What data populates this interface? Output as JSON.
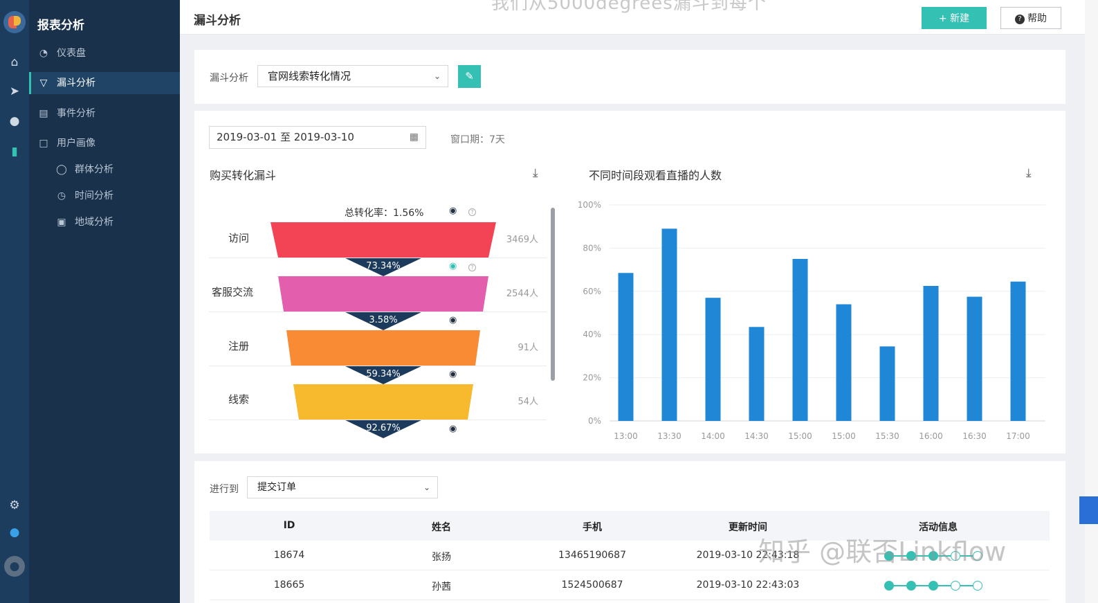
{
  "topbar": {
    "page_title": "漏斗分析",
    "watermark_top": "我们从5000degrees漏斗到每个",
    "new_button": "+ 新建",
    "help_button": "帮助"
  },
  "nav": {
    "title": "报表分析",
    "items": [
      {
        "label": "仪表盘",
        "icon": "dashboard-icon"
      },
      {
        "label": "漏斗分析",
        "icon": "funnel-icon"
      },
      {
        "label": "事件分析",
        "icon": "event-icon"
      },
      {
        "label": "用户画像",
        "icon": "folder-icon"
      },
      {
        "label": "群体分析",
        "icon": "group-icon"
      },
      {
        "label": "时间分析",
        "icon": "clock-icon"
      },
      {
        "label": "地域分析",
        "icon": "region-icon"
      }
    ]
  },
  "filter": {
    "label": "漏斗分析",
    "selected": "官网线索转化情况"
  },
  "date": {
    "range": "2019-03-01 至 2019-03-10",
    "window": "窗口期：7天"
  },
  "funnel": {
    "title": "购买转化漏斗",
    "total_rate": "总转化率：1.56%",
    "stages": [
      {
        "name": "访问",
        "count": "3469人",
        "color": "#f34456"
      },
      {
        "name": "客服交流",
        "count": "2544人",
        "color": "#e35fae"
      },
      {
        "name": "注册",
        "count": "91人",
        "color": "#f98b35"
      },
      {
        "name": "线索",
        "count": "54人",
        "color": "#f7b92e"
      }
    ],
    "rates": [
      "73.34%",
      "3.58%",
      "59.34%",
      "92.67%"
    ]
  },
  "chart_data": {
    "type": "bar",
    "title": "不同时间段观看直播的人数",
    "categories": [
      "13:00",
      "13:30",
      "14:00",
      "14:30",
      "15:00",
      "15:00",
      "15:30",
      "16:00",
      "16:30",
      "17:00"
    ],
    "values": [
      68.5,
      89,
      57,
      43.5,
      75,
      54,
      34.5,
      62.5,
      57.5,
      64.5
    ],
    "yticks": [
      "0%",
      "20%",
      "40%",
      "60%",
      "80%",
      "100%"
    ],
    "ylim": [
      0,
      100
    ],
    "color": "#1f87d6",
    "grid": true
  },
  "detail": {
    "label": "进行到",
    "selected": "提交订单",
    "columns": [
      "ID",
      "姓名",
      "手机",
      "更新时间",
      "活动信息"
    ],
    "rows": [
      {
        "id": "18674",
        "name": "张扬",
        "phone": "13465190687",
        "time": "2019-03-10 22:43:18",
        "progress": [
          1,
          1,
          1,
          0,
          0
        ]
      },
      {
        "id": "18665",
        "name": "孙茜",
        "phone": "1524500687",
        "time": "2019-03-10 22:43:03",
        "progress": [
          1,
          1,
          1,
          0,
          0
        ]
      }
    ]
  },
  "watermark_bottom": "知乎 @联否Linkflow"
}
